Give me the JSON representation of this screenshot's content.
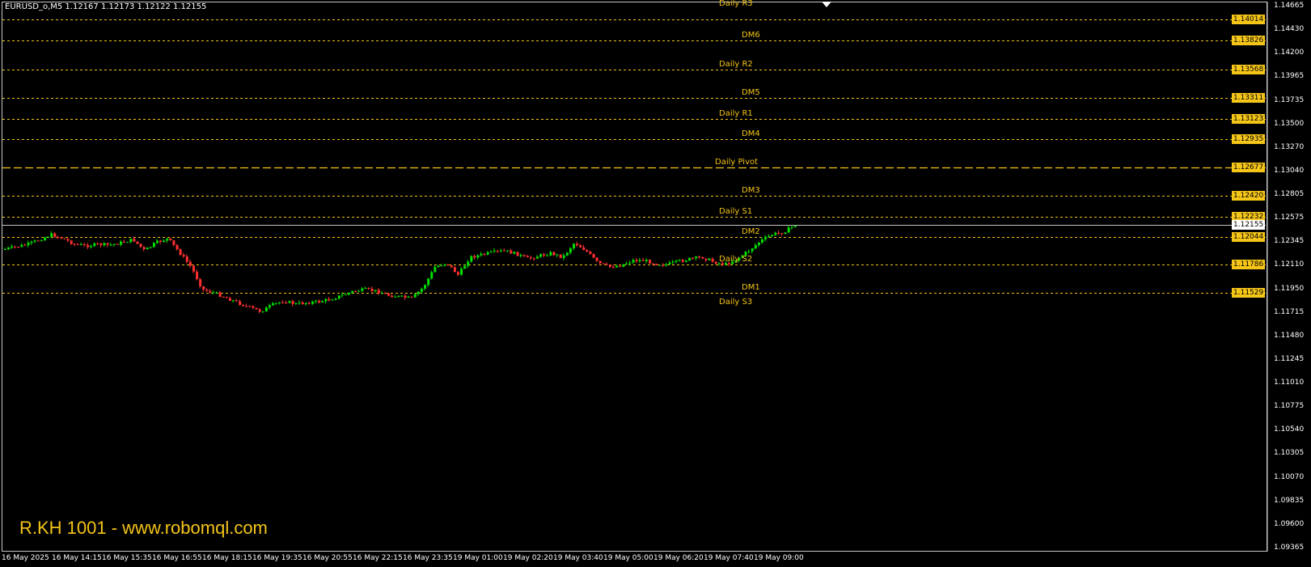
{
  "symbol_info": "EURUSD_o,M5  1.12167 1.12173 1.12122 1.12155",
  "watermark": "R.KH 1001 - www.robomql.com",
  "colors": {
    "background": "#000000",
    "level": "#f5c518",
    "bull_candle": "#00e000",
    "bear_candle": "#ff3030",
    "axis_text": "#ffffff"
  },
  "price_axis": {
    "min": 1.0934,
    "max": 1.1452,
    "ticks": [
      "1.14665",
      "1.14430",
      "1.14200",
      "1.13965",
      "1.13735",
      "1.13500",
      "1.13270",
      "1.13040",
      "1.12805",
      "1.12575",
      "1.12345",
      "1.12110",
      "1.11950",
      "1.11715",
      "1.11480",
      "1.11245",
      "1.11010",
      "1.10775",
      "1.10540",
      "1.10305",
      "1.10070",
      "1.09835",
      "1.09600",
      "1.09365"
    ],
    "current_price": "1.12155"
  },
  "levels": [
    {
      "name": "Daily R3",
      "price": "1.14014",
      "style": "dotted"
    },
    {
      "name": "DM6",
      "price": "1.13826",
      "style": "dotted"
    },
    {
      "name": "Daily R2",
      "price": "1.13568",
      "style": "dotted"
    },
    {
      "name": "DM5",
      "price": "1.13311",
      "style": "dotted"
    },
    {
      "name": "Daily R1",
      "price": "1.13123",
      "style": "dotted"
    },
    {
      "name": "DM4",
      "price": "1.12935",
      "style": "dotted"
    },
    {
      "name": "Daily Pivot",
      "price": "1.12677",
      "style": "dashed"
    },
    {
      "name": "DM3",
      "price": "1.12420",
      "style": "dotted"
    },
    {
      "name": "Daily S1",
      "price": "1.12232",
      "style": "dotted"
    },
    {
      "name": "DM2",
      "price": "1.12044",
      "style": "dotted"
    },
    {
      "name": "Daily S2",
      "price": "1.11786",
      "style": "dotted"
    },
    {
      "name": "DM1",
      "price": "1.11529",
      "style": "dotted"
    },
    {
      "name": "Daily S3",
      "price": "",
      "style": "dotted"
    }
  ],
  "time_axis": [
    "16 May 2025",
    "16 May 14:15",
    "16 May 15:35",
    "16 May 16:55",
    "16 May 18:15",
    "16 May 19:35",
    "16 May 20:55",
    "16 May 22:15",
    "16 May 23:35",
    "19 May 01:00",
    "19 May 02:20",
    "19 May 03:40",
    "19 May 05:00",
    "19 May 06:20",
    "19 May 07:40",
    "19 May 09:00"
  ],
  "chart_data": {
    "type": "candlestick",
    "symbol": "EURUSD_o",
    "timeframe": "M5",
    "close_path": [
      1.1194,
      1.1198,
      1.1196,
      1.1203,
      1.1207,
      1.1204,
      1.1201,
      1.1199,
      1.12,
      1.1198,
      1.1201,
      1.1203,
      1.1197,
      1.12,
      1.1202,
      1.119,
      1.118,
      1.1162,
      1.1158,
      1.1154,
      1.115,
      1.1146,
      1.1141,
      1.1143,
      1.1145,
      1.1142,
      1.1143,
      1.1144,
      1.1146,
      1.1149,
      1.1152,
      1.1154,
      1.1153,
      1.115,
      1.1149,
      1.1147,
      1.116,
      1.1178,
      1.1175,
      1.1172,
      1.1188,
      1.119,
      1.1192,
      1.1193,
      1.119,
      1.1185,
      1.1188,
      1.119,
      1.1186,
      1.12,
      1.1192,
      1.1182,
      1.1179,
      1.1181,
      1.1184,
      1.1184,
      1.1182,
      1.1181,
      1.1183,
      1.1185,
      1.1186,
      1.1182,
      1.1179,
      1.119,
      1.1198,
      1.1208,
      1.121,
      1.1212,
      1.1215
    ]
  }
}
